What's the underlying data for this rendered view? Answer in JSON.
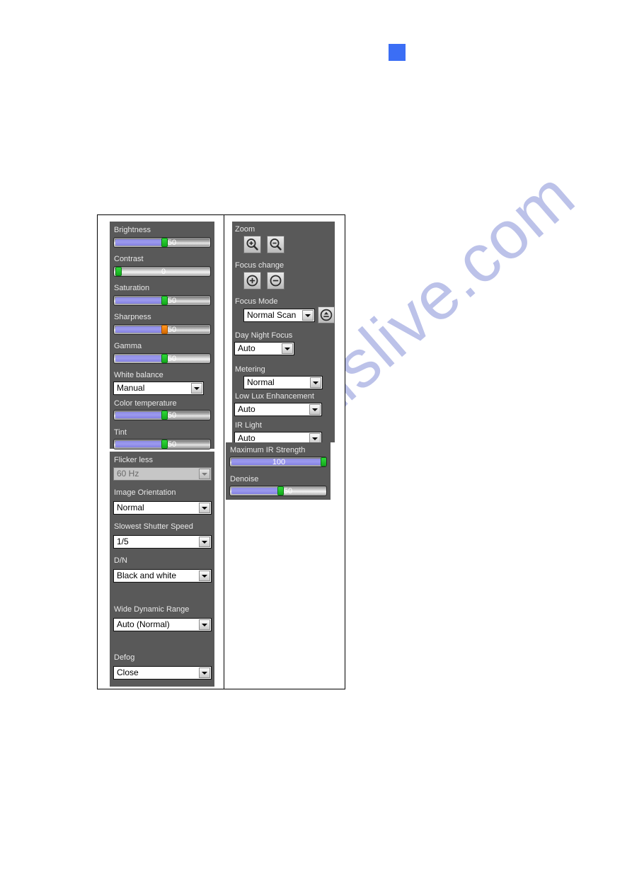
{
  "page": {
    "watermark_text": "manualslive.com",
    "accent_blue": "#3b6ef5",
    "panel_bg": "#595959"
  },
  "image_panel": {
    "sliders": [
      {
        "label": "Brightness",
        "value": "50",
        "percent": 50,
        "handle_color": "green"
      },
      {
        "label": "Contrast",
        "value": "0",
        "percent": 0,
        "handle_color": "green"
      },
      {
        "label": "Saturation",
        "value": "50",
        "percent": 50,
        "handle_color": "green"
      },
      {
        "label": "Sharpness",
        "value": "50",
        "percent": 50,
        "handle_color": "orange"
      },
      {
        "label": "Gamma",
        "value": "50",
        "percent": 50,
        "handle_color": "green"
      },
      {
        "label": "Color temperature",
        "value": "50",
        "percent": 50,
        "handle_color": "green"
      },
      {
        "label": "Tint",
        "value": "50",
        "percent": 50,
        "handle_color": "green"
      }
    ],
    "white_balance": {
      "label": "White balance",
      "value": "Manual"
    }
  },
  "exposure_panel": {
    "flicker_less": {
      "label": "Flicker less",
      "value": "60 Hz",
      "disabled": true
    },
    "image_orientation": {
      "label": "Image Orientation",
      "value": "Normal"
    },
    "slowest_shutter_speed": {
      "label": "Slowest Shutter Speed",
      "value": "1/5"
    },
    "dn": {
      "label": "D/N",
      "value": "Black and white"
    },
    "wide_dynamic_range": {
      "label": "Wide Dynamic Range",
      "value": "Auto (Normal)"
    },
    "defog": {
      "label": "Defog",
      "value": "Close"
    }
  },
  "lens_panel": {
    "zoom": {
      "label": "Zoom",
      "in_icon": "zoom-in-icon",
      "out_icon": "zoom-out-icon"
    },
    "focus_change": {
      "label": "Focus change",
      "near_icon": "focus-plus-icon",
      "far_icon": "focus-minus-icon"
    },
    "focus_mode": {
      "label": "Focus Mode",
      "value": "Normal Scan",
      "reset_icon": "focus-reset-icon"
    },
    "day_night_focus": {
      "label": "Day Night Focus",
      "value": "Auto"
    },
    "metering": {
      "label": "Metering",
      "value": "Normal"
    },
    "low_lux_enhancement": {
      "label": "Low Lux Enhancement",
      "value": "Auto"
    },
    "ir_light": {
      "label": "IR Light",
      "value": "Auto"
    }
  },
  "ir_panel": {
    "sliders": [
      {
        "label": "Maximum IR Strength",
        "value": "100",
        "percent": 100,
        "handle_color": "green"
      },
      {
        "label": "Denoise",
        "value": "50",
        "percent": 50,
        "handle_color": "green"
      }
    ]
  }
}
